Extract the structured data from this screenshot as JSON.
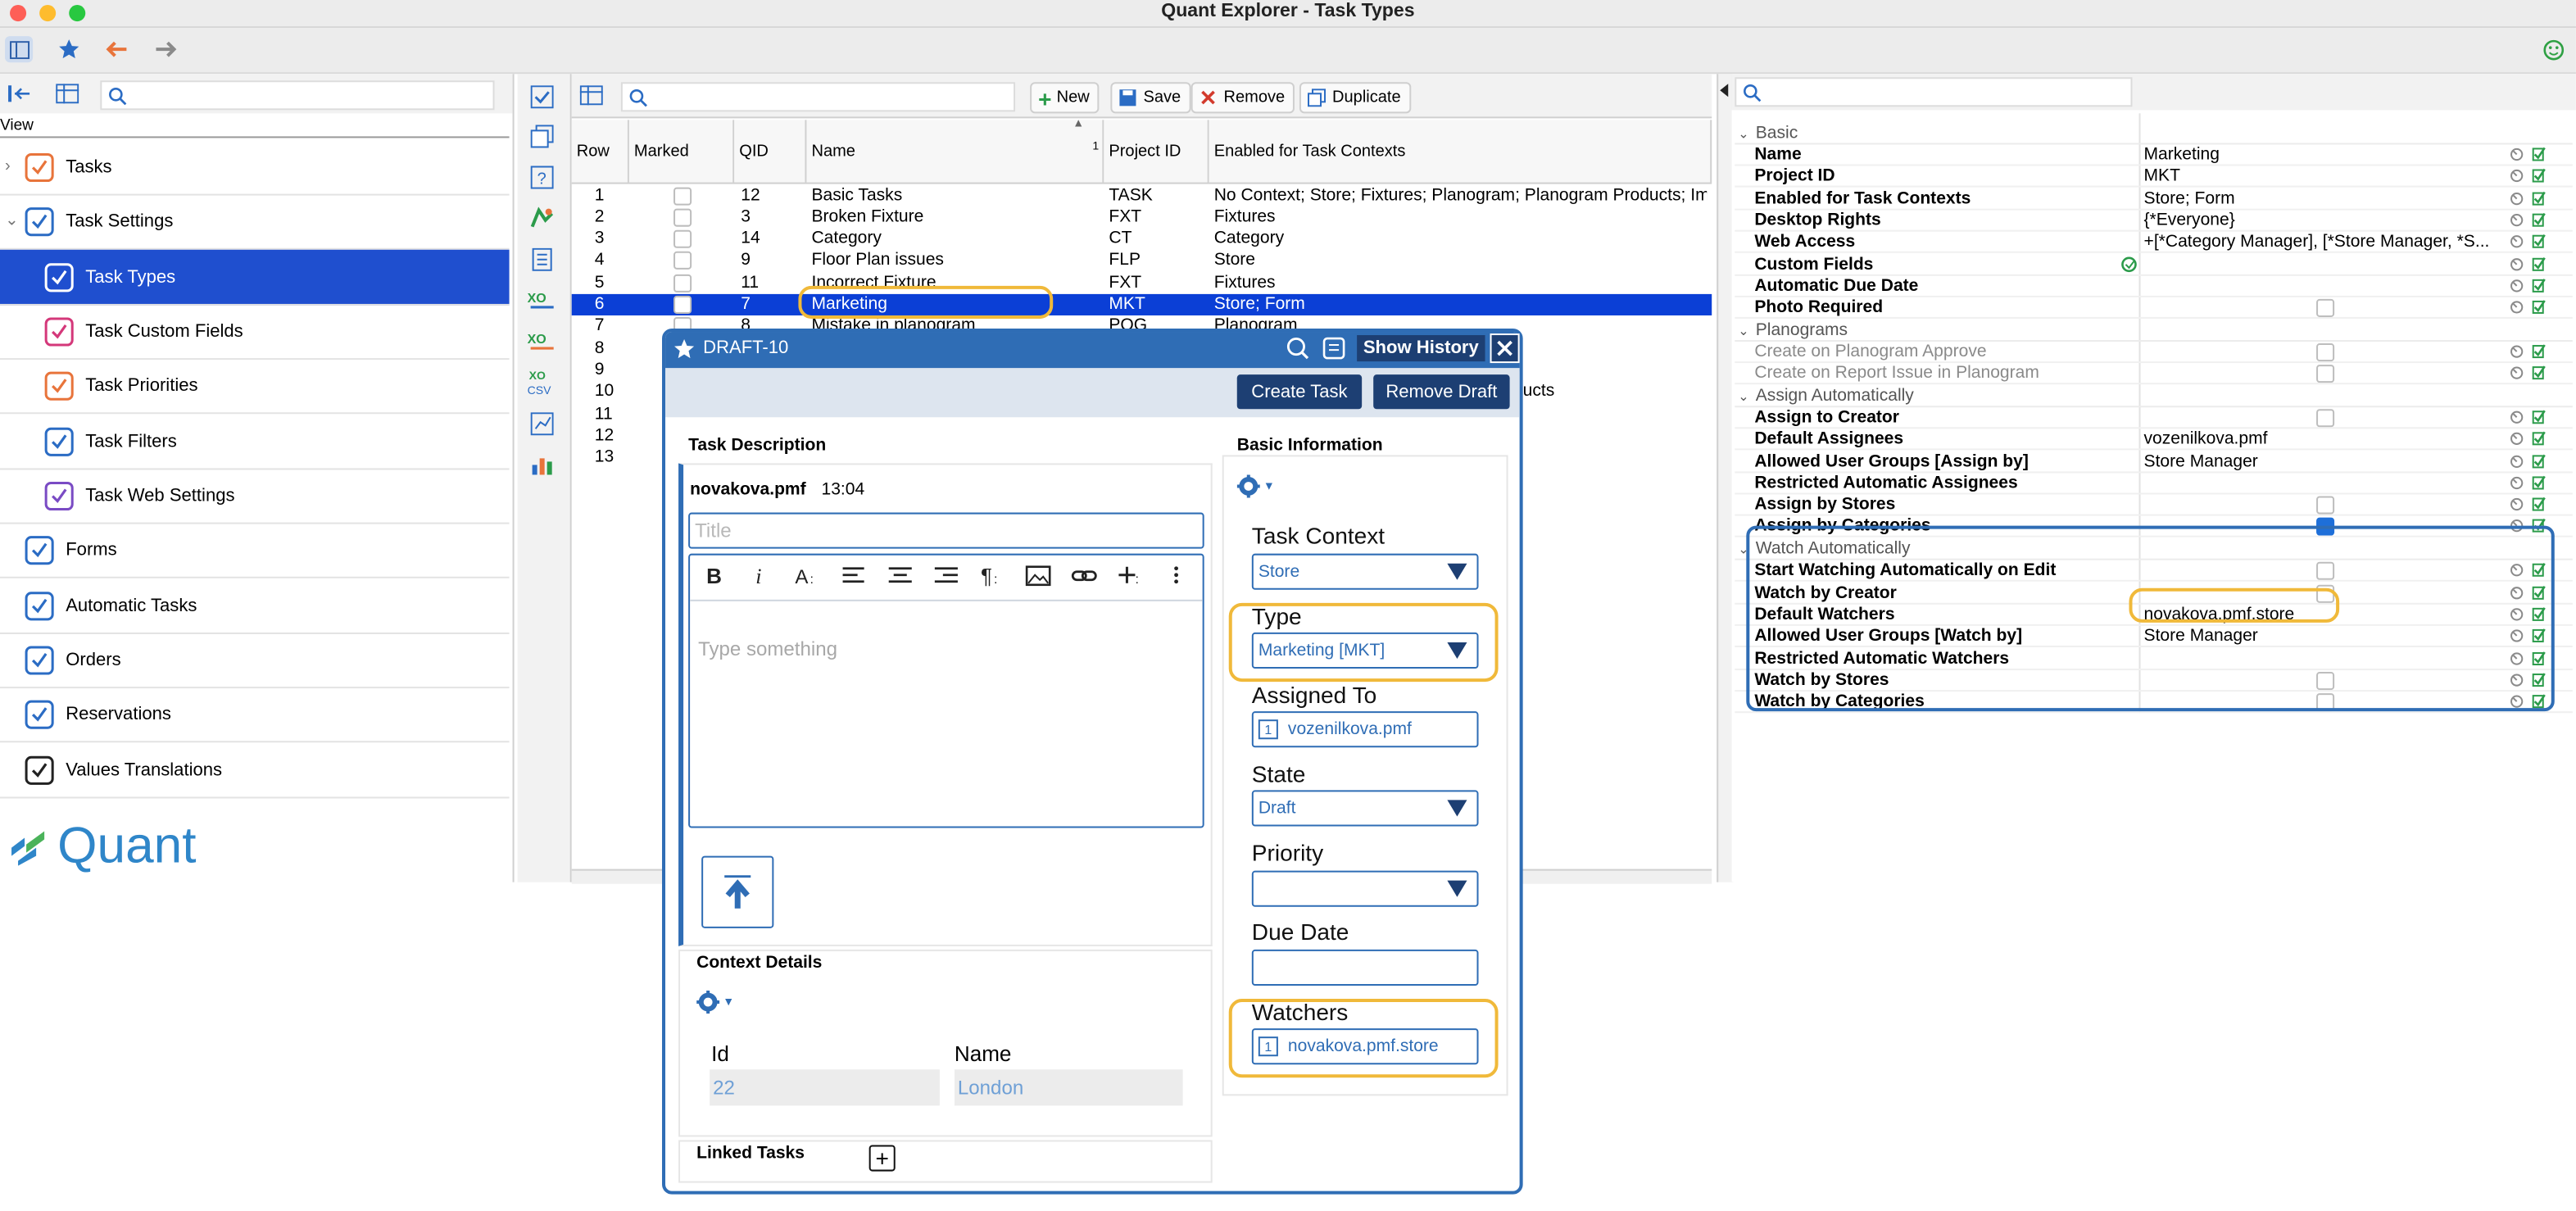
{
  "window": {
    "title": "Quant Explorer - Task Types"
  },
  "left": {
    "search_placeholder": "",
    "view_label": "View",
    "nav": [
      {
        "label": "Tasks",
        "icon": "tasks-icon"
      },
      {
        "label": "Task Settings",
        "icon": "task-settings-icon"
      },
      {
        "label": "Task Types",
        "icon": "task-types-icon",
        "selected": true
      },
      {
        "label": "Task Custom Fields",
        "icon": "task-custom-fields-icon"
      },
      {
        "label": "Task Priorities",
        "icon": "task-priorities-icon"
      },
      {
        "label": "Task Filters",
        "icon": "task-filters-icon"
      },
      {
        "label": "Task Web Settings",
        "icon": "task-web-settings-icon"
      },
      {
        "label": "Forms",
        "icon": "forms-icon"
      },
      {
        "label": "Automatic Tasks",
        "icon": "automatic-tasks-icon"
      },
      {
        "label": "Orders",
        "icon": "orders-icon"
      },
      {
        "label": "Reservations",
        "icon": "reservations-icon"
      },
      {
        "label": "Values Translations",
        "icon": "values-translations-icon"
      }
    ],
    "logo_text": "Quant"
  },
  "center": {
    "toolbar": {
      "new": "New",
      "save": "Save",
      "remove": "Remove",
      "duplicate": "Duplicate"
    },
    "columns": [
      "Row",
      "Marked",
      "QID",
      "Name",
      "Project ID",
      "Enabled for Task Contexts"
    ],
    "sort_indicator": "1",
    "rows": [
      {
        "row": "1",
        "qid": "12",
        "name": "Basic Tasks",
        "pid": "TASK",
        "ctx": "No Context; Store; Fixtures; Planogram; Planogram Products; Im"
      },
      {
        "row": "2",
        "qid": "3",
        "name": "Broken Fixture",
        "pid": "FXT",
        "ctx": "Fixtures"
      },
      {
        "row": "3",
        "qid": "14",
        "name": "Category",
        "pid": "CT",
        "ctx": "Category"
      },
      {
        "row": "4",
        "qid": "9",
        "name": "Floor Plan issues",
        "pid": "FLP",
        "ctx": "Store"
      },
      {
        "row": "5",
        "qid": "11",
        "name": "Incorrect Fixture",
        "pid": "FXT",
        "ctx": "Fixtures"
      },
      {
        "row": "6",
        "qid": "7",
        "name": "Marketing",
        "pid": "MKT",
        "ctx": "Store; Form"
      },
      {
        "row": "7",
        "qid": "8",
        "name": "Mistake in planogram",
        "pid": "POG",
        "ctx": "Planogram"
      },
      {
        "row": "8",
        "qid": "",
        "name": "",
        "pid": "",
        "ctx": ""
      },
      {
        "row": "9",
        "qid": "",
        "name": "",
        "pid": "",
        "ctx": ""
      },
      {
        "row": "10",
        "qid": "",
        "name": "",
        "pid": "",
        "ctx": "ucts"
      },
      {
        "row": "11",
        "qid": "",
        "name": "",
        "pid": "",
        "ctx": ""
      },
      {
        "row": "12",
        "qid": "",
        "name": "",
        "pid": "",
        "ctx": ""
      },
      {
        "row": "13",
        "qid": "",
        "name": "",
        "pid": "",
        "ctx": ""
      }
    ]
  },
  "dialog": {
    "title": "DRAFT-10",
    "show_history": "Show History",
    "create_task": "Create Task",
    "remove_draft": "Remove Draft",
    "task_description": "Task Description",
    "author": "novakova.pmf",
    "time": "13:04",
    "title_placeholder": "Title",
    "body_placeholder": "Type something",
    "basic_information": "Basic Information",
    "task_context_label": "Task Context",
    "task_context_value": "Store",
    "type_label": "Type",
    "type_value": "Marketing [MKT]",
    "assigned_label": "Assigned To",
    "assigned_count": "1",
    "assigned_value": "vozenilkova.pmf",
    "state_label": "State",
    "state_value": "Draft",
    "priority_label": "Priority",
    "priority_value": "",
    "due_label": "Due Date",
    "watchers_label": "Watchers",
    "watchers_count": "1",
    "watchers_value": "novakova.pmf.store",
    "context_details": "Context Details",
    "id_label": "Id",
    "id_value": "22",
    "name_label": "Name",
    "name_value": "London",
    "linked_tasks": "Linked Tasks"
  },
  "props": {
    "search_placeholder": "",
    "sections": {
      "basic": "Basic",
      "planograms": "Planograms",
      "assign": "Assign Automatically",
      "watch": "Watch Automatically"
    },
    "rows": {
      "name": {
        "label": "Name",
        "value": "Marketing"
      },
      "project_id": {
        "label": "Project ID",
        "value": "MKT"
      },
      "enabled": {
        "label": "Enabled for Task Contexts",
        "value": "Store; Form"
      },
      "desktop": {
        "label": "Desktop Rights",
        "value": "{*Everyone}"
      },
      "web": {
        "label": "Web Access",
        "value": "+[*Category Manager], [*Store Manager, *S..."
      },
      "custom": {
        "label": "Custom Fields",
        "value": ""
      },
      "due": {
        "label": "Automatic Due Date",
        "value": ""
      },
      "photo": {
        "label": "Photo Required",
        "value": ""
      },
      "pog_approve": {
        "label": "Create on Planogram Approve",
        "value": ""
      },
      "pog_report": {
        "label": "Create on Report Issue in Planogram",
        "value": ""
      },
      "assign_creator": {
        "label": "Assign to Creator",
        "value": ""
      },
      "default_assignees": {
        "label": "Default Assignees",
        "value": "vozenilkova.pmf"
      },
      "allowed_assign": {
        "label": "Allowed User Groups [Assign by]",
        "value": "Store Manager"
      },
      "restricted_assign": {
        "label": "Restricted Automatic Assignees",
        "value": ""
      },
      "assign_stores": {
        "label": "Assign by Stores",
        "value": ""
      },
      "assign_categories": {
        "label": "Assign by Categories",
        "value": ""
      },
      "watch_edit": {
        "label": "Start Watching Automatically on Edit",
        "value": ""
      },
      "watch_creator": {
        "label": "Watch by Creator",
        "value": ""
      },
      "default_watchers": {
        "label": "Default Watchers",
        "value": "novakova.pmf.store"
      },
      "allowed_watch": {
        "label": "Allowed User Groups [Watch by]",
        "value": "Store Manager"
      },
      "restricted_watch": {
        "label": "Restricted Automatic Watchers",
        "value": ""
      },
      "watch_stores": {
        "label": "Watch by Stores",
        "value": ""
      },
      "watch_categories": {
        "label": "Watch by Categories",
        "value": ""
      }
    }
  },
  "colors": {
    "selection": "#0b3fd6",
    "nav_selection": "#1f4fcf",
    "dialog_border": "#2f6db5",
    "highlight": "#f0b93a"
  }
}
